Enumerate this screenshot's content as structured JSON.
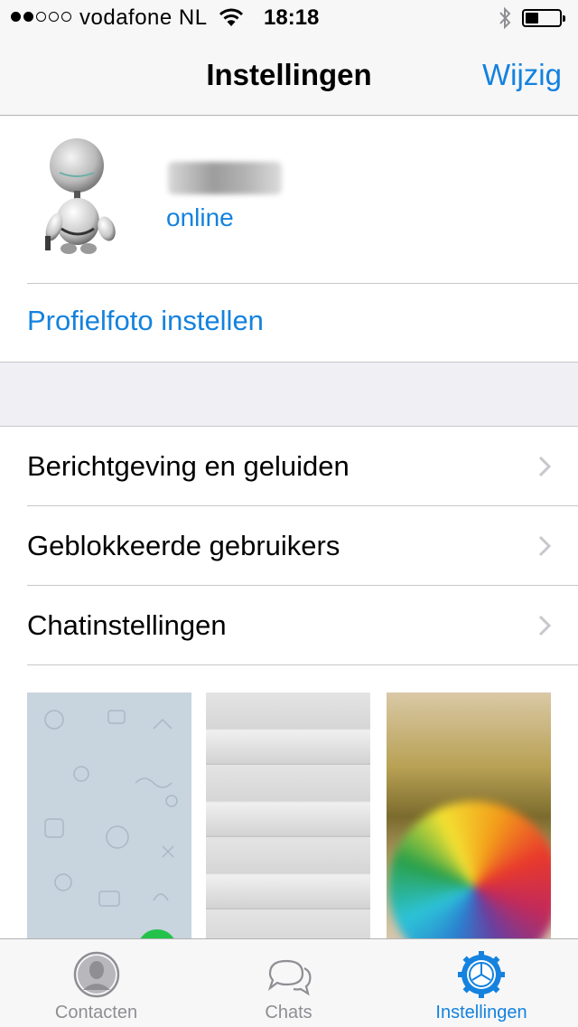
{
  "status_bar": {
    "carrier": "vodafone NL",
    "time": "18:18",
    "signal_bars_filled": 2,
    "signal_bars_total": 5,
    "battery_level": 0.3
  },
  "nav": {
    "title": "Instellingen",
    "edit": "Wijzig"
  },
  "profile": {
    "status": "online",
    "set_photo": "Profielfoto instellen"
  },
  "settings": {
    "items": [
      {
        "label": "Berichtgeving en geluiden",
        "icon": "chevron-right-icon"
      },
      {
        "label": "Geblokkeerde gebruikers",
        "icon": "chevron-right-icon"
      },
      {
        "label": "Chatinstellingen",
        "icon": "chevron-right-icon"
      }
    ]
  },
  "wallpapers": [
    "doodle-pattern",
    "white-wood",
    "colorful-umbrella"
  ],
  "tabs": [
    {
      "label": "Contacten",
      "icon": "person-icon",
      "active": false
    },
    {
      "label": "Chats",
      "icon": "chat-bubbles-icon",
      "active": false
    },
    {
      "label": "Instellingen",
      "icon": "gear-icon",
      "active": true
    }
  ],
  "colors": {
    "accent": "#1482de",
    "inactive": "#8e8e93",
    "selected_check": "#24c24a"
  }
}
